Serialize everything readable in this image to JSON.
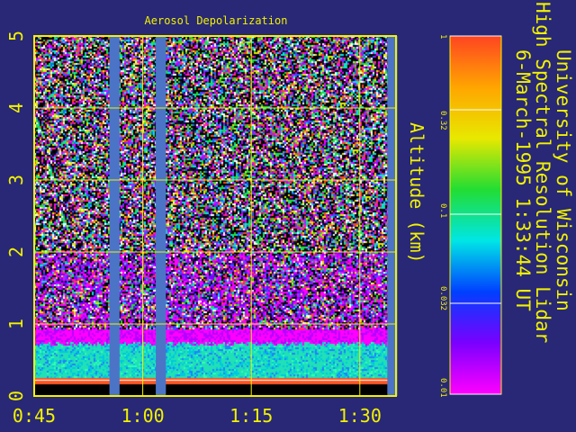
{
  "chart_data": {
    "type": "heatmap",
    "title": "Aerosol Depolarization",
    "ylabel": "Altitude (km)",
    "xlabel": "",
    "y_ticks": [
      "0",
      "1",
      "2",
      "3",
      "4",
      "5"
    ],
    "x_ticks": [
      "0:45",
      "1:00",
      "1:15",
      "1:30"
    ],
    "ylim": [
      0,
      5
    ],
    "xlim_minutes": [
      45,
      95
    ],
    "x_tick_minutes": [
      45,
      60,
      75,
      90
    ],
    "gaps_minutes": [
      [
        55.4,
        56.8
      ],
      [
        61.8,
        63.2
      ],
      [
        93.8,
        95.2
      ]
    ],
    "data_gap": {
      "start": "0:55",
      "end": "1:02"
    },
    "boundary_layer_top_km": 0.9,
    "grid": true,
    "colorbar": {
      "scale": "log",
      "ticks": [
        "1",
        "0.32",
        "0.1",
        "0.032",
        "0.01"
      ],
      "colors": [
        "#ff4422",
        "#ffa500",
        "#e8e800",
        "#22dd33",
        "#00e6e6",
        "#0040ff",
        "#7a00ff",
        "#ff00ff"
      ]
    },
    "colors": {
      "background": "#282876",
      "axes": "#f2f200",
      "text": "#f2f200",
      "gap": "#4b74c6",
      "boundary_layer": "#22e0b5",
      "surface_band": "#ff5522"
    }
  },
  "institution_line1": "University of Wisconsin",
  "institution_line2": "High Spectral Resolution Lidar",
  "timestamp": "6-March-1995   1:33:44 UT"
}
